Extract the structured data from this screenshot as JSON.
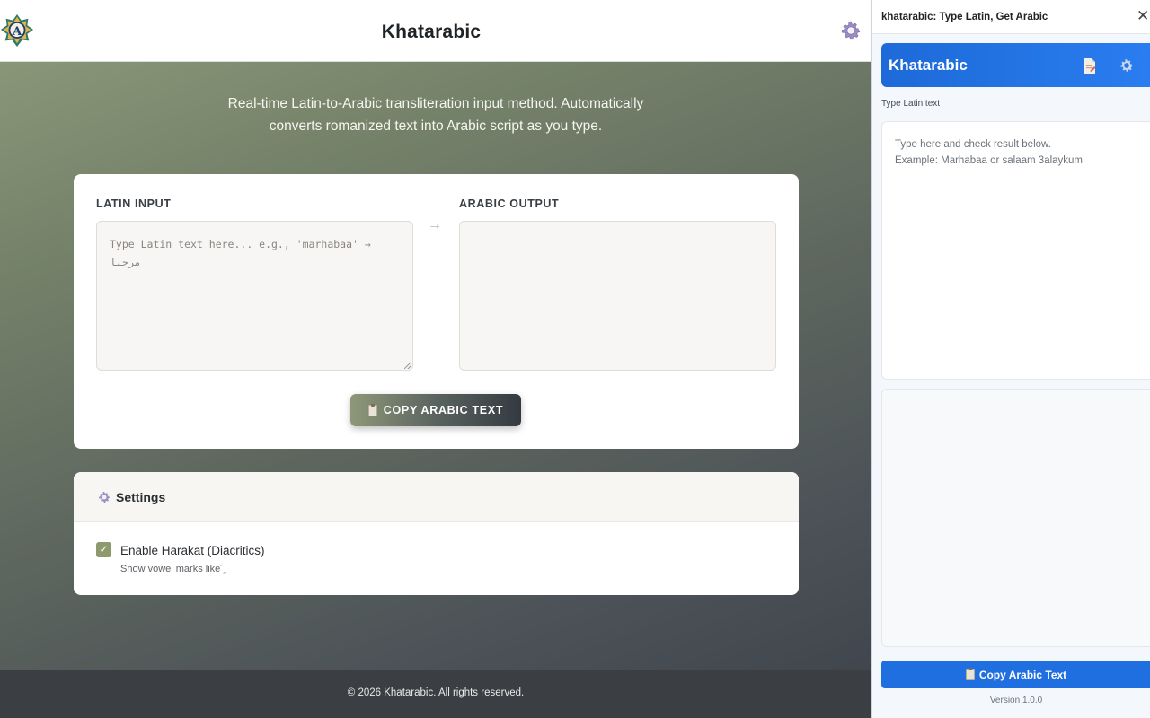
{
  "app": {
    "title": "Khatarabic",
    "logo_letter": "A",
    "tagline": "Real-time Latin-to-Arabic transliteration input method. Automatically converts romanized text into Arabic script as you type."
  },
  "editor": {
    "latin_label": "LATIN INPUT",
    "arabic_label": "ARABIC OUTPUT",
    "latin_placeholder": "Type Latin text here... e.g., 'marhabaa' → مرحبا",
    "arrow": "→",
    "arabic_value": "",
    "copy_label": "COPY ARABIC TEXT"
  },
  "settings": {
    "title": "Settings",
    "harakat_label": "Enable Harakat (Diacritics)",
    "harakat_hint": "Show vowel marks like َ ِ",
    "harakat_checked": true,
    "check_mark": "✓"
  },
  "footer": {
    "text": "© 2026 Khatarabic. All rights reserved."
  },
  "panel": {
    "header_title": "khatarabic: Type Latin, Get Arabic",
    "close_glyph": "✕",
    "brand_name": "Khatarabic",
    "input_label": "Type Latin text",
    "input_placeholder": "Type here and check result below.\nExample: Marhabaa or salaam 3alaykum",
    "output_value": "",
    "copy_label": "Copy Arabic Text",
    "version": "Version 1.0.0"
  },
  "colors": {
    "accent_olive": "#8c9a6e",
    "panel_blue": "#1f6fe0",
    "footer_dark": "#3b3e42"
  },
  "icons": [
    "logo-emblem",
    "gear-icon",
    "clipboard-icon",
    "document-icon",
    "close-icon",
    "check-icon",
    "arrow-right-icon"
  ]
}
